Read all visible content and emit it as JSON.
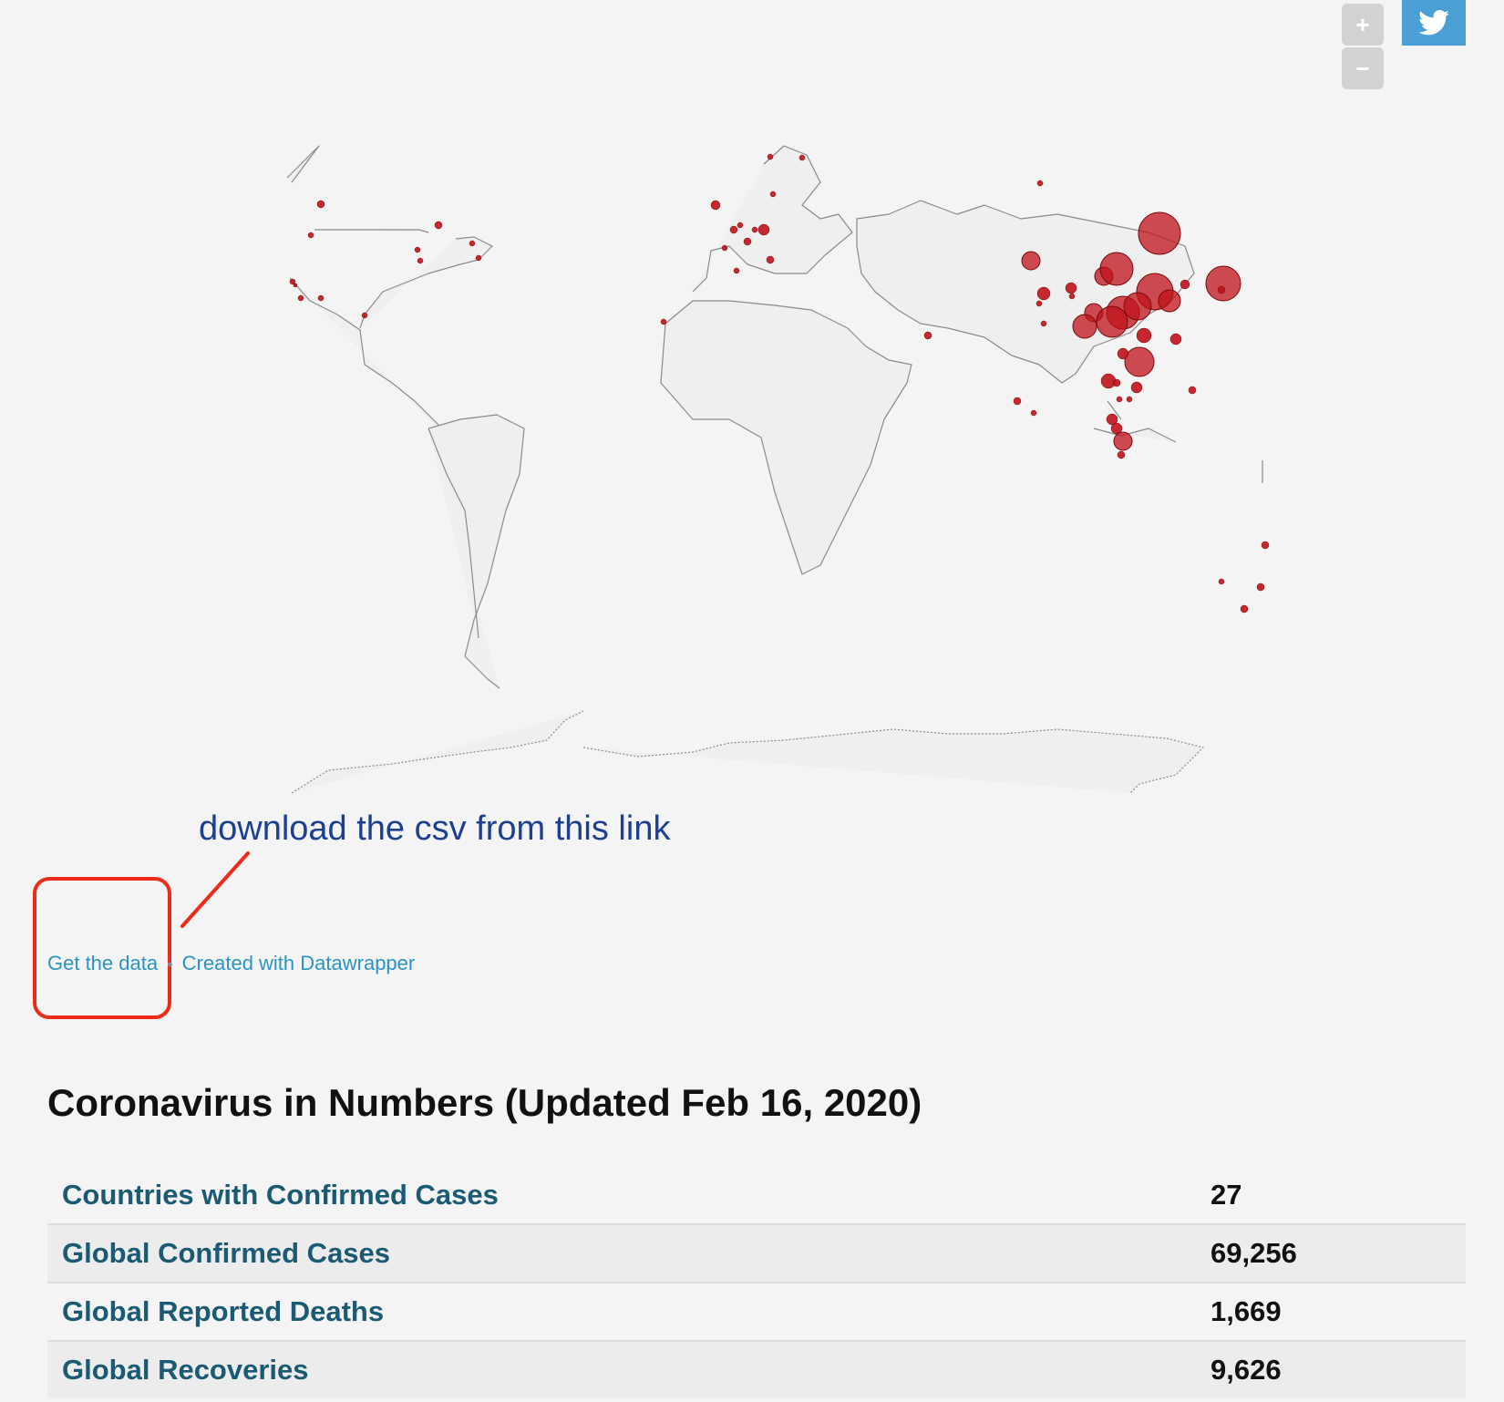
{
  "controls": {
    "zoom_in": "+",
    "zoom_out": "−",
    "share_icon": "twitter-icon"
  },
  "map": {
    "marker_color": "#c0121a",
    "border_color": "#8a8a8a",
    "land_color": "#efefef"
  },
  "annotation": {
    "text": "download the csv from this link",
    "color": "#1c3f94",
    "highlight_color": "#ee2a1a"
  },
  "footer": {
    "get_data": "Get the data",
    "separator": "•",
    "created_with": "Created with Datawrapper",
    "link_color": "#2a94c4"
  },
  "stats": {
    "title": "Coronavirus in Numbers (Updated Feb 16, 2020)",
    "rows": [
      {
        "label": "Countries with Confirmed Cases",
        "value": "27"
      },
      {
        "label": "Global Confirmed Cases",
        "value": "69,256"
      },
      {
        "label": "Global Reported Deaths",
        "value": "1,669"
      },
      {
        "label": "Global Recoveries",
        "value": "9,626"
      }
    ]
  }
}
